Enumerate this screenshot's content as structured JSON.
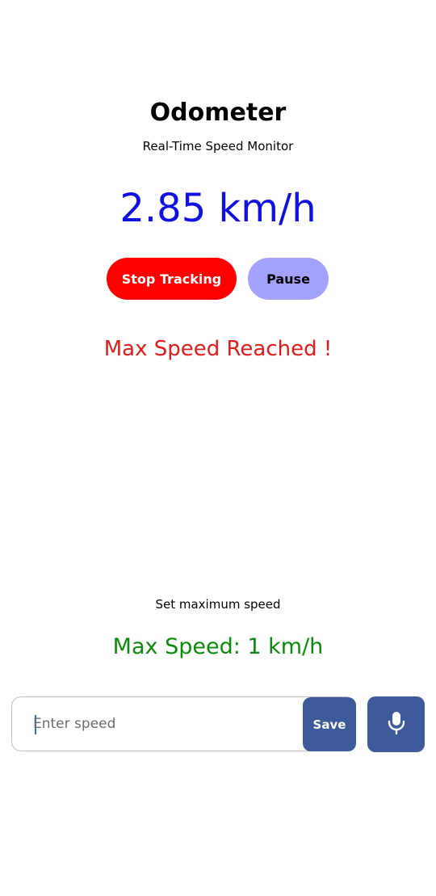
{
  "header": {
    "title": "Odometer",
    "subtitle": "Real-Time Speed Monitor"
  },
  "speed_display": {
    "value": "2.85 km/h",
    "color": "#1010e0"
  },
  "controls": {
    "stop_label": "Stop Tracking",
    "stop_color": "#ff0000",
    "pause_label": "Pause",
    "pause_color": "#a3a3ff"
  },
  "alert": {
    "text": "Max Speed Reached !",
    "color": "#e01b1b"
  },
  "max_speed_section": {
    "label": "Set maximum speed",
    "value_text": "Max Speed: 1 km/h",
    "value_color": "#0a8a0a"
  },
  "input": {
    "placeholder": "Enter speed",
    "value": ""
  },
  "buttons": {
    "save_label": "Save",
    "save_color": "#3d5a9a",
    "mic_icon": "microphone-icon",
    "mic_color": "#3d5a9a"
  }
}
